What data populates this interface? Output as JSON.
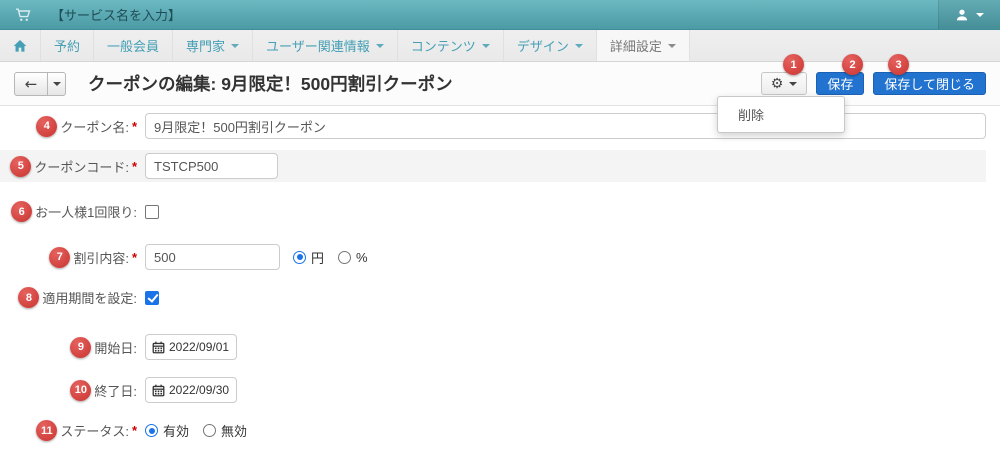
{
  "colors": {
    "topbar_teal": "#55a6b0",
    "nav_link_teal": "#45a0b5",
    "primary_button_blue": "#2173cf",
    "annotation_badge_red": "#d03c38",
    "control_accent_blue": "#1a73e8",
    "required_asterisk_red": "#cc0000",
    "striped_row_gray": "#f4f4f4"
  },
  "topbar": {
    "service_name": "【サービス名を入力】"
  },
  "nav": {
    "items": [
      {
        "label": "予約"
      },
      {
        "label": "一般会員"
      },
      {
        "label": "専門家"
      },
      {
        "label": "ユーザー関連情報"
      },
      {
        "label": "コンテンツ"
      },
      {
        "label": "デザイン"
      },
      {
        "label": "詳細設定"
      }
    ]
  },
  "header": {
    "title": "クーポンの編集: 9月限定！500円割引クーポン",
    "save_label": "保存",
    "save_close_label": "保存して閉じる",
    "gear_menu_items": [
      {
        "label": "削除"
      }
    ]
  },
  "annotations": [
    "1",
    "2",
    "3",
    "4",
    "5",
    "6",
    "7",
    "8",
    "9",
    "10",
    "11"
  ],
  "form": {
    "coupon_name": {
      "label": "クーポン名:",
      "required": "*",
      "value": "9月限定！500円割引クーポン"
    },
    "coupon_code": {
      "label": "クーポンコード:",
      "required": "*",
      "value": "TSTCP500"
    },
    "once_per_person": {
      "label": "お一人様1回限り:",
      "checked": false
    },
    "discount": {
      "label": "割引内容:",
      "required": "*",
      "value": "500",
      "unit_options": [
        {
          "label": "円",
          "selected": true
        },
        {
          "label": "%",
          "selected": false
        }
      ]
    },
    "set_period": {
      "label": "適用期間を設定:",
      "checked": true
    },
    "start_date": {
      "label": "開始日:",
      "value": "2022/09/01"
    },
    "end_date": {
      "label": "終了日:",
      "value": "2022/09/30"
    },
    "status": {
      "label": "ステータス:",
      "required": "*",
      "options": [
        {
          "label": "有効",
          "selected": true
        },
        {
          "label": "無効",
          "selected": false
        }
      ]
    }
  }
}
